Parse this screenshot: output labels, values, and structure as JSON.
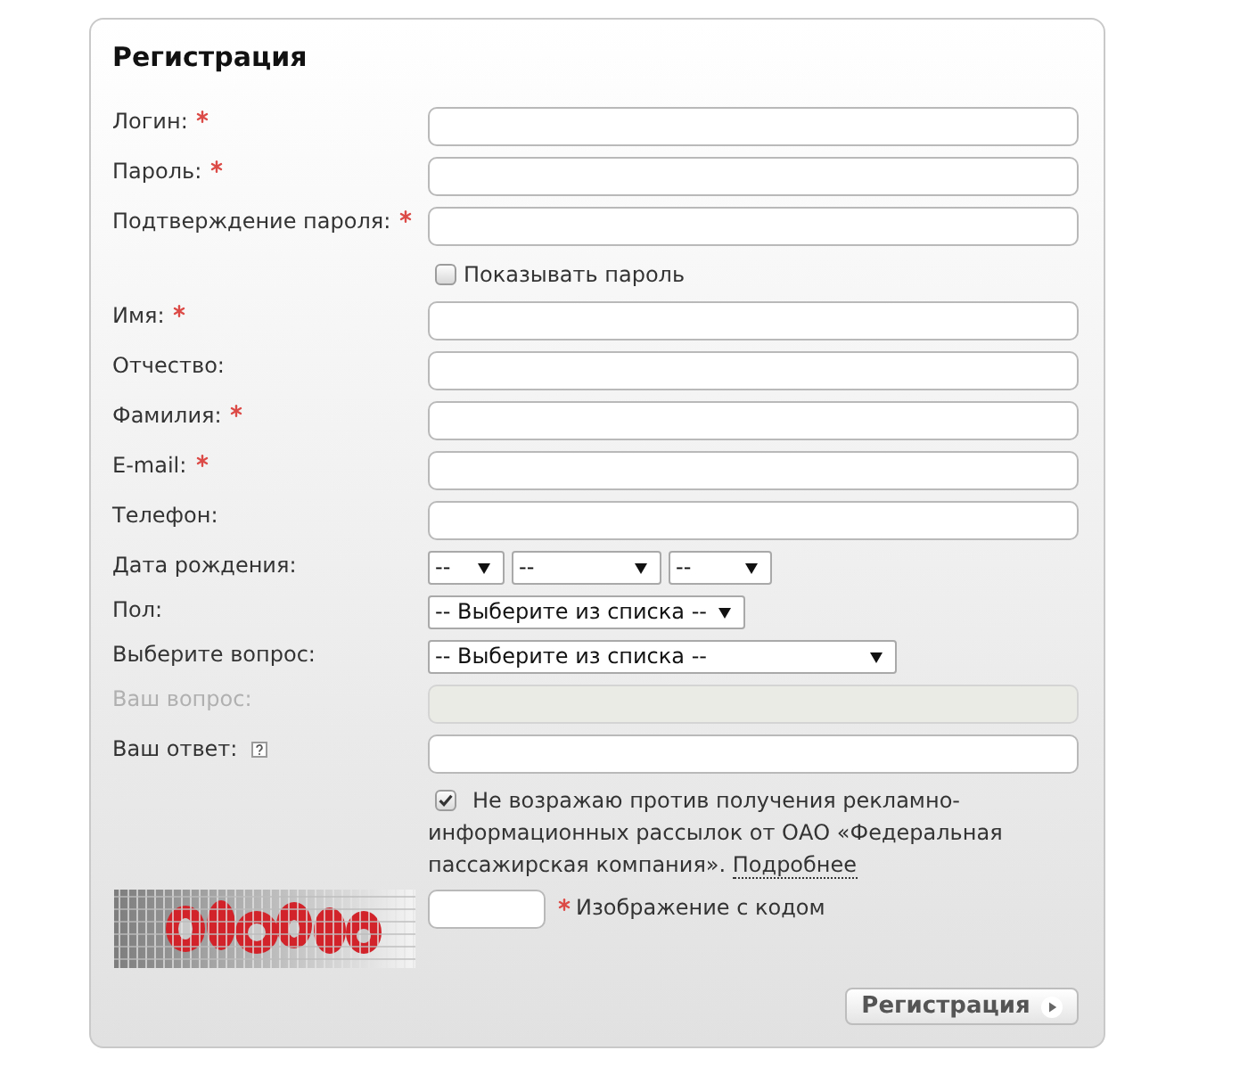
{
  "form": {
    "title": "Регистрация"
  },
  "rows": [
    {
      "kind": "text",
      "label": "Логин:",
      "required": true,
      "disabled": false,
      "help": false
    },
    {
      "kind": "text",
      "label": "Пароль:",
      "required": true,
      "disabled": false,
      "help": false
    },
    {
      "kind": "text",
      "label": "Подтверждение пароля:",
      "required": true,
      "disabled": false,
      "help": false
    },
    {
      "kind": "checkbox",
      "label": "Показывать пароль",
      "checked": false
    },
    {
      "kind": "text",
      "label": "Имя:",
      "required": true,
      "disabled": false,
      "help": false
    },
    {
      "kind": "text",
      "label": "Отчество:",
      "required": false,
      "disabled": false,
      "help": false
    },
    {
      "kind": "text",
      "label": "Фамилия:",
      "required": true,
      "disabled": false,
      "help": false
    },
    {
      "kind": "text",
      "label": "E-mail:",
      "required": true,
      "disabled": false,
      "help": false
    },
    {
      "kind": "text",
      "label": "Телефон:",
      "required": false,
      "disabled": false,
      "help": false
    },
    {
      "kind": "date",
      "label": "Дата рождения:",
      "required": false,
      "disabled": false,
      "help": false,
      "selects": [
        {
          "value": "--"
        },
        {
          "value": "--"
        },
        {
          "value": "--"
        }
      ]
    },
    {
      "kind": "select",
      "label": "Пол:",
      "value": "-- Выберите из списка --",
      "required": false,
      "disabled": false,
      "help": false
    },
    {
      "kind": "select",
      "label": "Выберите вопрос:",
      "value": "-- Выберите из списка --",
      "required": false,
      "disabled": false,
      "help": false
    },
    {
      "kind": "text",
      "label": "Ваш вопрос:",
      "required": false,
      "disabled": true,
      "help": false
    },
    {
      "kind": "text",
      "label": "Ваш ответ:",
      "required": false,
      "disabled": false,
      "help": true
    }
  ],
  "consent": {
    "checked": true,
    "text": "Не возражаю против получения рекламно-информационных рассылок от ОАО «Федеральная пассажирская компания».",
    "link": "Подробнее"
  },
  "captcha": {
    "label": "Изображение с кодом",
    "required": true
  },
  "submit": {
    "label": "Регистрация"
  }
}
